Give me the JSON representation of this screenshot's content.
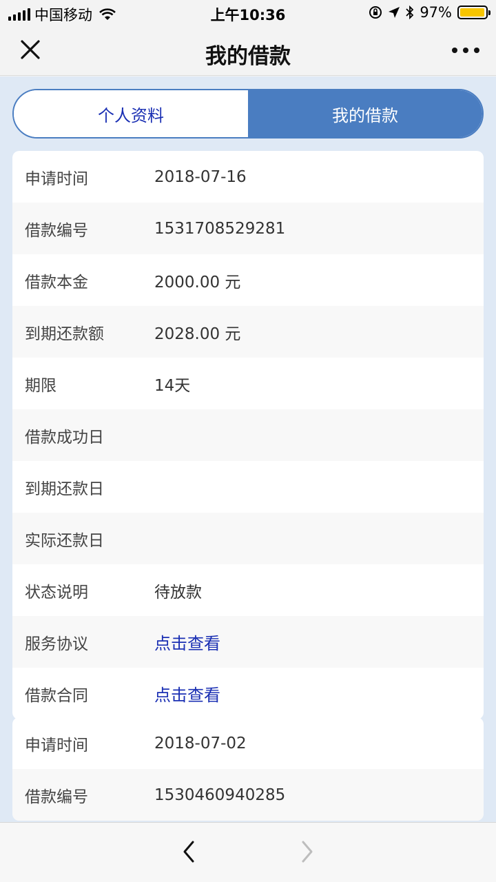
{
  "status": {
    "carrier": "中国移动",
    "time": "上午10:36",
    "battery": "97%",
    "battery_level": 0.97
  },
  "nav": {
    "title": "我的借款",
    "close_icon": "close-icon",
    "more_icon": "more-dots-icon"
  },
  "tabs": [
    {
      "label": "个人资料",
      "active": false
    },
    {
      "label": "我的借款",
      "active": true
    }
  ],
  "loans": [
    {
      "rows": [
        {
          "label": "申请时间",
          "value": "2018-07-16"
        },
        {
          "label": "借款编号",
          "value": "1531708529281"
        },
        {
          "label": "借款本金",
          "value": "2000.00 元"
        },
        {
          "label": "到期还款额",
          "value": "2028.00 元"
        },
        {
          "label": "期限",
          "value": "14天"
        },
        {
          "label": "借款成功日",
          "value": ""
        },
        {
          "label": "到期还款日",
          "value": ""
        },
        {
          "label": "实际还款日",
          "value": ""
        },
        {
          "label": "状态说明",
          "value": "待放款"
        },
        {
          "label": "服务协议",
          "value": "点击查看"
        },
        {
          "label": "借款合同",
          "value": "点击查看"
        }
      ]
    },
    {
      "rows": [
        {
          "label": "申请时间",
          "value": "2018-07-02"
        },
        {
          "label": "借款编号",
          "value": "1530460940285"
        }
      ]
    }
  ],
  "colors": {
    "accent": "#4a7dc1",
    "link": "#1a2fb3",
    "battery": "#f7c500",
    "background": "#dfe9f5"
  }
}
